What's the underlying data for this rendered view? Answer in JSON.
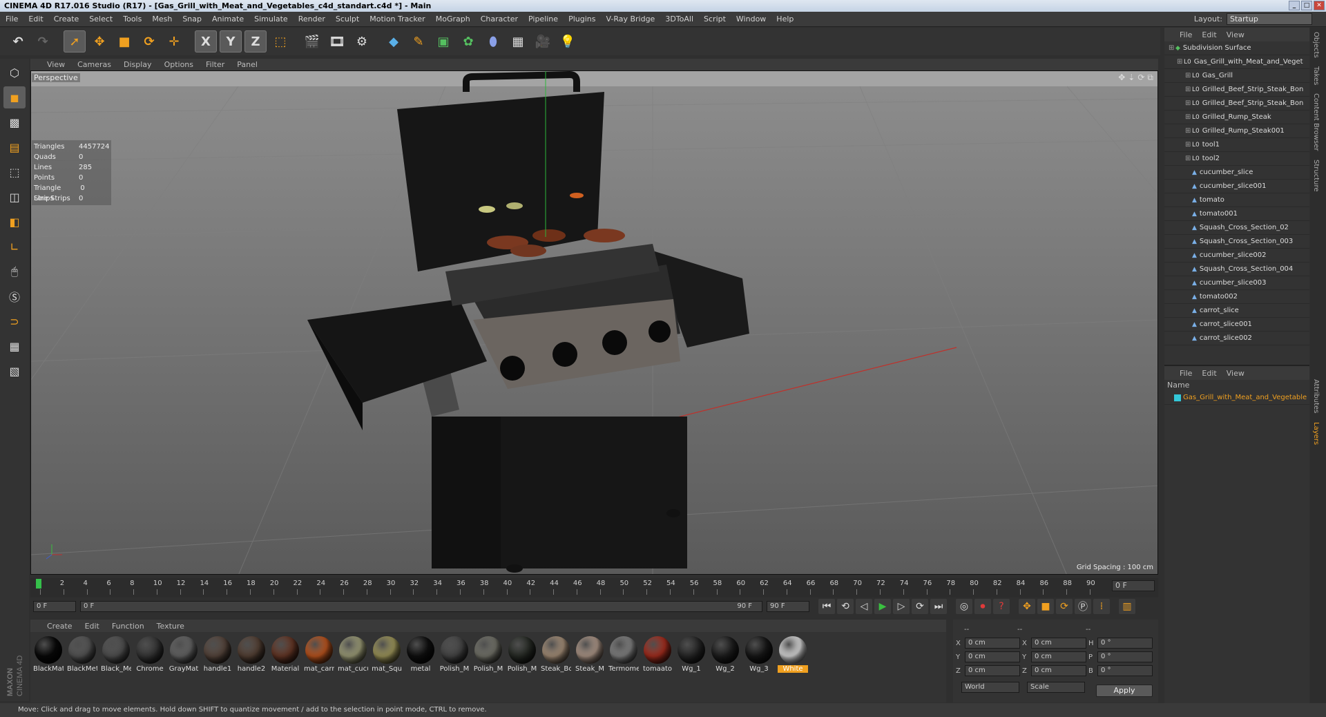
{
  "window": {
    "title": "CINEMA 4D R17.016 Studio (R17) - [Gas_Grill_with_Meat_and_Vegetables_c4d_standart.c4d *] - Main"
  },
  "menubar": [
    "File",
    "Edit",
    "Create",
    "Select",
    "Tools",
    "Mesh",
    "Snap",
    "Animate",
    "Simulate",
    "Render",
    "Sculpt",
    "Motion Tracker",
    "MoGraph",
    "Character",
    "Pipeline",
    "Plugins",
    "V-Ray Bridge",
    "3DToAll",
    "Script",
    "Window",
    "Help"
  ],
  "layout": {
    "label": "Layout:",
    "value": "Startup"
  },
  "toolbar": {
    "axis_x": "X",
    "axis_y": "Y",
    "axis_z": "Z"
  },
  "viewport": {
    "menu": [
      "View",
      "Cameras",
      "Display",
      "Options",
      "Filter",
      "Panel"
    ],
    "camera_label": "Perspective",
    "stats": [
      {
        "label": "Triangles",
        "value": "4457724"
      },
      {
        "label": "Quads",
        "value": "0"
      },
      {
        "label": "Lines",
        "value": "285"
      },
      {
        "label": "Points",
        "value": "0"
      },
      {
        "label": "Triangle Strips",
        "value": "0"
      },
      {
        "label": "Line Strips",
        "value": "0"
      }
    ],
    "grid_spacing": "Grid Spacing : 100 cm"
  },
  "timeline": {
    "ticks": [
      "0",
      "2",
      "4",
      "6",
      "8",
      "10",
      "12",
      "14",
      "16",
      "18",
      "20",
      "22",
      "24",
      "26",
      "28",
      "30",
      "32",
      "34",
      "36",
      "38",
      "40",
      "42",
      "44",
      "46",
      "48",
      "50",
      "52",
      "54",
      "56",
      "58",
      "60",
      "62",
      "64",
      "66",
      "68",
      "70",
      "72",
      "74",
      "76",
      "78",
      "80",
      "82",
      "84",
      "86",
      "88",
      "90"
    ],
    "current_frame": "0 F"
  },
  "transport": {
    "start": "0 F",
    "range_start": "0 F",
    "range_end": "90 F",
    "end": "90 F"
  },
  "material_panel": {
    "menu": [
      "Create",
      "Edit",
      "Function",
      "Texture"
    ],
    "materials": [
      {
        "name": "BlackMat",
        "color": "#0a0a0a"
      },
      {
        "name": "BlackMet",
        "color": "#5a5a5a"
      },
      {
        "name": "Black_Me",
        "color": "#555555"
      },
      {
        "name": "Chrome",
        "color": "#3a3a3a"
      },
      {
        "name": "GrayMat",
        "color": "#6a6a6a"
      },
      {
        "name": "handle1",
        "color": "#5c4a40"
      },
      {
        "name": "handle2",
        "color": "#5a4538"
      },
      {
        "name": "Material",
        "color": "#6b3a28"
      },
      {
        "name": "mat_carr",
        "color": "#c85a20"
      },
      {
        "name": "mat_cucu",
        "color": "#a8a880"
      },
      {
        "name": "mat_Squ",
        "color": "#a8a060"
      },
      {
        "name": "metal",
        "color": "#111111"
      },
      {
        "name": "Polish_M",
        "color": "#4a4a4a"
      },
      {
        "name": "Polish_M",
        "color": "#7a7a70"
      },
      {
        "name": "Polish_M",
        "color": "#2a2e28"
      },
      {
        "name": "Steak_Bc",
        "color": "#b09880"
      },
      {
        "name": "Steak_M",
        "color": "#b8a090"
      },
      {
        "name": "Termome",
        "color": "#8a8a8a"
      },
      {
        "name": "tomaato",
        "color": "#b03020"
      },
      {
        "name": "Wg_1",
        "color": "#2a2a2a"
      },
      {
        "name": "Wg_2",
        "color": "#202020"
      },
      {
        "name": "Wg_3",
        "color": "#1a1a1a"
      },
      {
        "name": "White",
        "color": "#e8e8e8"
      }
    ],
    "selected_material": "White"
  },
  "coords": {
    "headers": [
      "--",
      "--",
      "--"
    ],
    "rows": [
      {
        "a": "X",
        "av": "0 cm",
        "b": "X",
        "bv": "0 cm",
        "c": "H",
        "cv": "0 °"
      },
      {
        "a": "Y",
        "av": "0 cm",
        "b": "Y",
        "bv": "0 cm",
        "c": "P",
        "cv": "0 °"
      },
      {
        "a": "Z",
        "av": "0 cm",
        "b": "Z",
        "bv": "0 cm",
        "c": "B",
        "cv": "0 °"
      }
    ],
    "mode1": "World",
    "mode2": "Scale",
    "apply": "Apply"
  },
  "object_manager": {
    "menu": [
      "File",
      "Edit",
      "View"
    ],
    "items": [
      {
        "name": "Subdivision Surface",
        "type": "subdiv",
        "indent": 0
      },
      {
        "name": "Gas_Grill_with_Meat_and_Veget",
        "type": "null",
        "indent": 1
      },
      {
        "name": "Gas_Grill",
        "type": "null",
        "indent": 2
      },
      {
        "name": "Grilled_Beef_Strip_Steak_Bon",
        "type": "null",
        "indent": 2
      },
      {
        "name": "Grilled_Beef_Strip_Steak_Bon",
        "type": "null",
        "indent": 2
      },
      {
        "name": "Grilled_Rump_Steak",
        "type": "null",
        "indent": 2
      },
      {
        "name": "Grilled_Rump_Steak001",
        "type": "null",
        "indent": 2
      },
      {
        "name": "tool1",
        "type": "null",
        "indent": 2
      },
      {
        "name": "tool2",
        "type": "null",
        "indent": 2
      },
      {
        "name": "cucumber_slice",
        "type": "poly",
        "indent": 2
      },
      {
        "name": "cucumber_slice001",
        "type": "poly",
        "indent": 2
      },
      {
        "name": "tomato",
        "type": "poly",
        "indent": 2
      },
      {
        "name": "tomato001",
        "type": "poly",
        "indent": 2
      },
      {
        "name": "Squash_Cross_Section_02",
        "type": "poly",
        "indent": 2
      },
      {
        "name": "Squash_Cross_Section_003",
        "type": "poly",
        "indent": 2
      },
      {
        "name": "cucumber_slice002",
        "type": "poly",
        "indent": 2
      },
      {
        "name": "Squash_Cross_Section_004",
        "type": "poly",
        "indent": 2
      },
      {
        "name": "cucumber_slice003",
        "type": "poly",
        "indent": 2
      },
      {
        "name": "tomato002",
        "type": "poly",
        "indent": 2
      },
      {
        "name": "carrot_slice",
        "type": "poly",
        "indent": 2
      },
      {
        "name": "carrot_slice001",
        "type": "poly",
        "indent": 2
      },
      {
        "name": "carrot_slice002",
        "type": "poly",
        "indent": 2
      }
    ]
  },
  "layer_manager": {
    "menu": [
      "File",
      "Edit",
      "View"
    ],
    "column": "Name",
    "layer": "Gas_Grill_with_Meat_and_Vegetable",
    "layer_color": "#33c7d8"
  },
  "side_tabs": [
    "Objects",
    "Takes",
    "Content Browser",
    "Structure",
    "Attributes",
    "Layers"
  ],
  "status": "Move: Click and drag to move elements. Hold down SHIFT to quantize movement / add to the selection in point mode, CTRL to remove.",
  "branding": "MAXON CINEMA 4D"
}
